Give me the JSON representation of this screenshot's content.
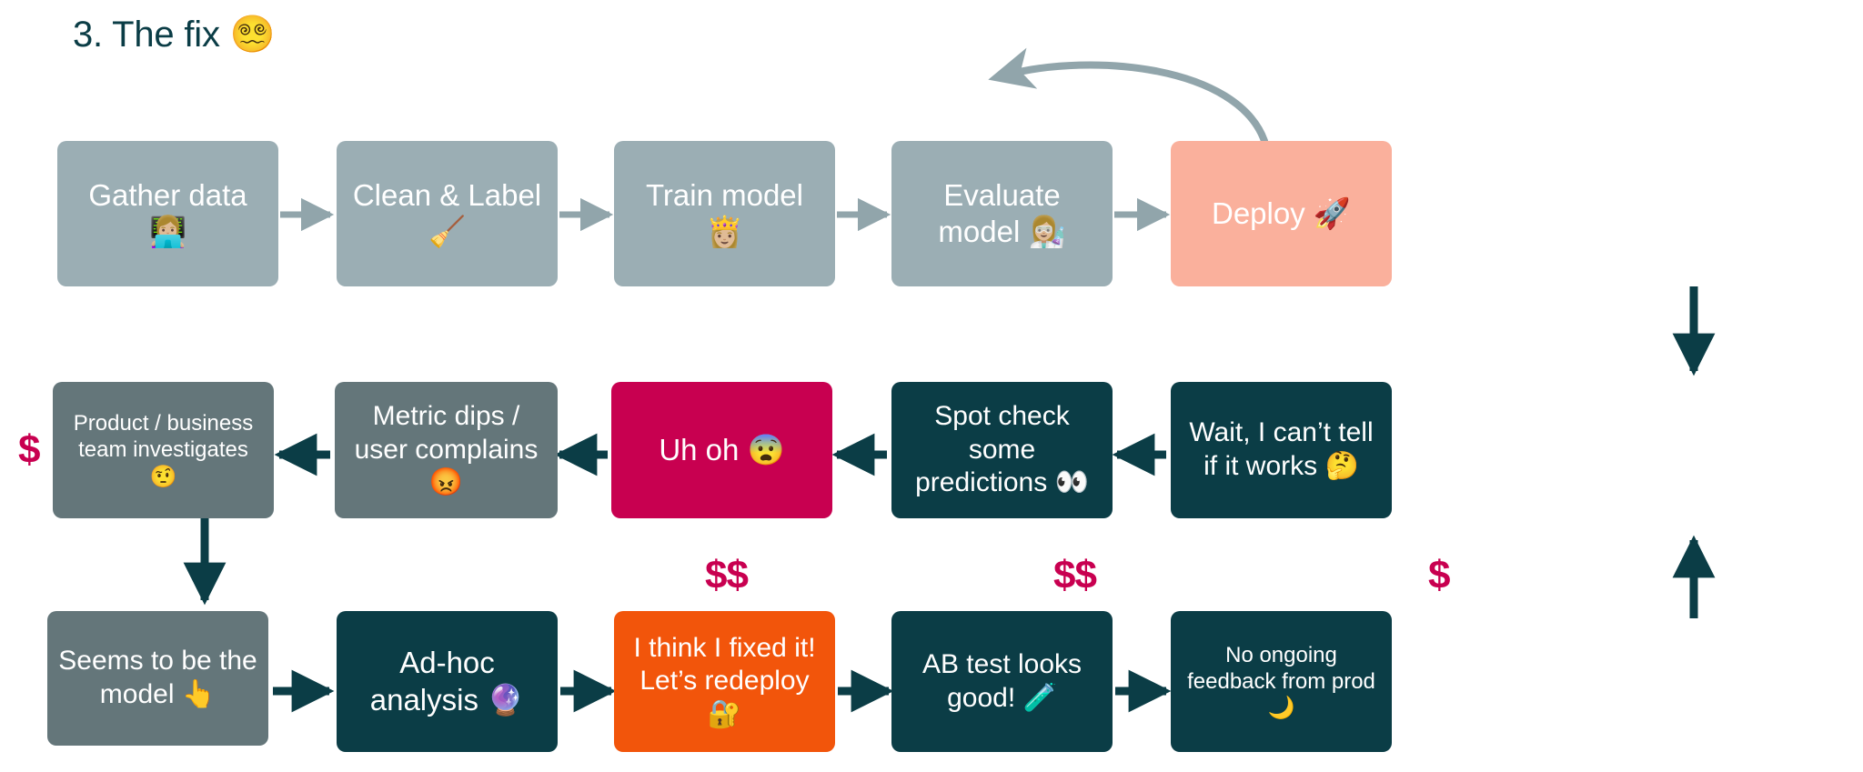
{
  "title": "3. The fix 😵‍💫",
  "colors": {
    "title_text": "#0B3D46",
    "steel": "#9BAEB4",
    "salmon": "#FAB09C",
    "slate": "#64767A",
    "crimson": "#C80050",
    "teal": "#0B3D46",
    "orange": "#F2550B",
    "money_text": "#C80050",
    "arrow_steel": "#91A5AB",
    "arrow_teal": "#0B3D46",
    "node_text": "#FFFFFF",
    "background": "#FFFFFF"
  },
  "rows": {
    "row1": {
      "nodes": [
        {
          "id": "gather-data",
          "label": "Gather data 👩🏼‍💻",
          "color": "steel",
          "size": "lg"
        },
        {
          "id": "clean-label",
          "label": "Clean & Label 🧹",
          "color": "steel",
          "size": "lg"
        },
        {
          "id": "train-model",
          "label": "Train model 👸🏼",
          "color": "steel",
          "size": "lg"
        },
        {
          "id": "evaluate-model",
          "label": "Evaluate model 👩🏼‍🔬",
          "color": "steel",
          "size": "lg"
        },
        {
          "id": "deploy",
          "label": "Deploy 🚀",
          "color": "salmon",
          "size": "lg"
        }
      ]
    },
    "row2": {
      "nodes": [
        {
          "id": "product-business-team-investigates",
          "label": "Product / business team investigates 🤨",
          "color": "slate",
          "size": "sm"
        },
        {
          "id": "metric-dips-user-complains",
          "label": "Metric dips / user complains 😡",
          "color": "slate",
          "size": "md"
        },
        {
          "id": "uh-oh",
          "label": "Uh oh 😨",
          "color": "crimson",
          "size": "lg"
        },
        {
          "id": "spot-check-some-predictions",
          "label": "Spot check some predictions 👀",
          "color": "teal",
          "size": "md"
        },
        {
          "id": "wait-i-cant-tell-if-it-works",
          "label": "Wait, I can’t tell if it works 🤔",
          "color": "teal",
          "size": "md"
        }
      ]
    },
    "row3": {
      "nodes": [
        {
          "id": "seems-to-be-the-model",
          "label": "Seems to be the model 👆",
          "color": "slate",
          "size": "md"
        },
        {
          "id": "ad-hoc-analysis",
          "label": "Ad-hoc analysis 🔮",
          "color": "teal",
          "size": "lg"
        },
        {
          "id": "i-think-i-fixed-it",
          "label": "I think I fixed it! Let’s redeploy 🔐",
          "color": "orange",
          "size": "md"
        },
        {
          "id": "ab-test-looks-good",
          "label": "AB test looks good! 🧪",
          "color": "teal",
          "size": "md"
        },
        {
          "id": "no-ongoing-feedback-from-prod",
          "label": "No ongoing feedback from prod 🌙",
          "color": "teal",
          "size": "sm"
        }
      ]
    }
  },
  "cost_markers": [
    {
      "id": "cost-left",
      "label": "$"
    },
    {
      "id": "cost-ad-hoc",
      "label": "$$"
    },
    {
      "id": "cost-redeploy",
      "label": "$$"
    },
    {
      "id": "cost-ab-test",
      "label": "$"
    }
  ]
}
